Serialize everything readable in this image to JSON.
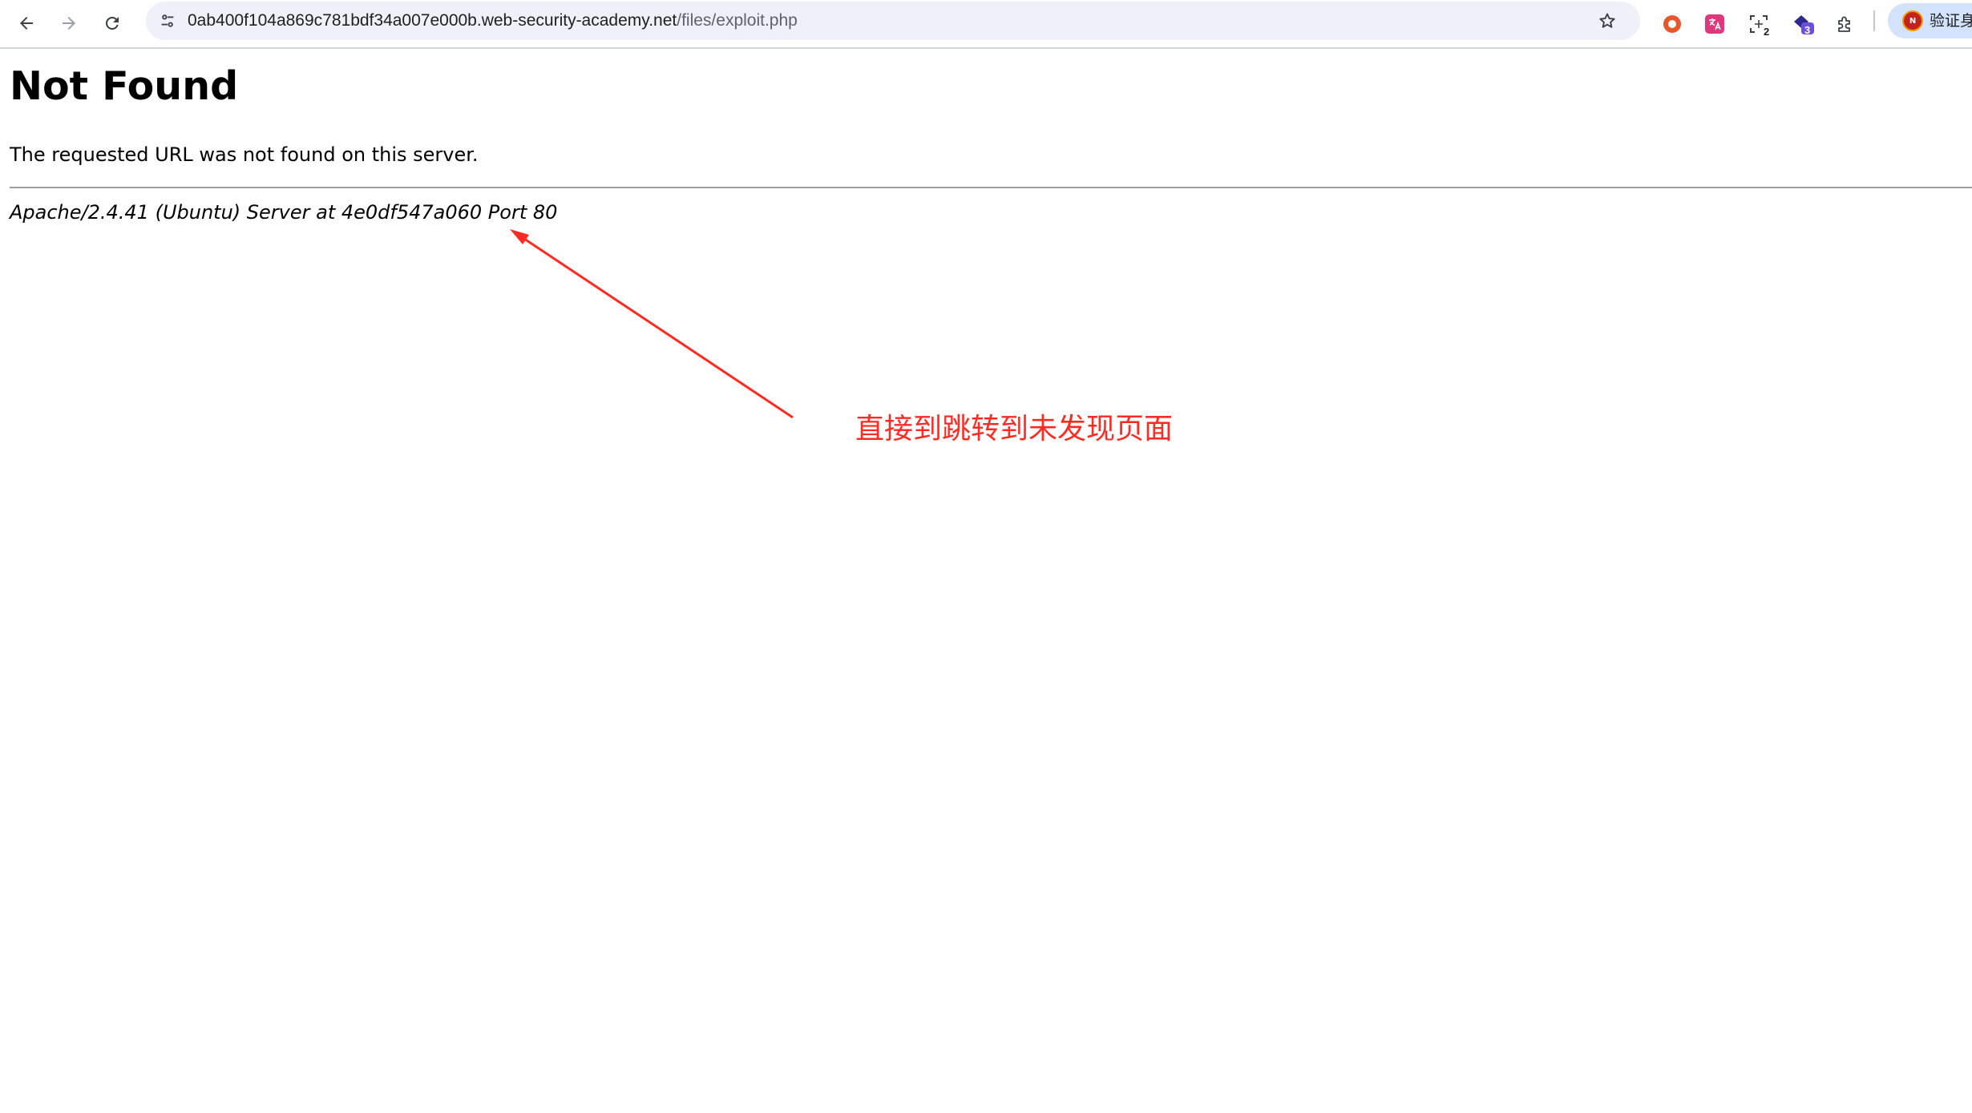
{
  "browser": {
    "url_host": "0ab400f104a869c781bdf34a007e000b.web-security-academy.net",
    "url_path": "/files/exploit.php",
    "nav_icons": [
      "back-arrow-icon",
      "forward-arrow-icon",
      "reload-icon"
    ],
    "site_info_icon": "tune-icon",
    "bookmark_icon": "star-outline-icon",
    "extensions": [
      {
        "icon": "record-circle-icon",
        "badge": "",
        "color": "#e8572b"
      },
      {
        "icon": "translate-icon",
        "badge": "",
        "color": "#e0367c"
      },
      {
        "icon": "screenshot-icon",
        "badge": "2",
        "color": "#3c4043"
      },
      {
        "icon": "gem-icon",
        "badge": "3",
        "color": "#5b3ec8"
      },
      {
        "icon": "puzzle-icon",
        "badge": "",
        "color": "#3c4043"
      }
    ],
    "profile": {
      "avatar_letter": "N",
      "label": "验证身"
    }
  },
  "page": {
    "title": "Not Found",
    "message": "The requested URL was not found on this server.",
    "server_signature": "Apache/2.4.41 (Ubuntu) Server at 4e0df547a060 Port 80"
  },
  "annotation": {
    "text": "直接到跳转到未发现页面",
    "color": "#ff2a22"
  }
}
